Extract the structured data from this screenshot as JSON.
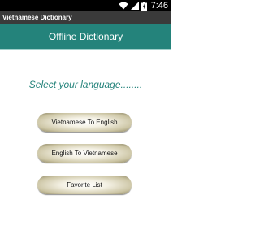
{
  "status_bar": {
    "time": "7:46",
    "icons": [
      "wifi-icon",
      "signal-icon",
      "battery-charging-icon"
    ]
  },
  "app_title": "Vietnamese Dictionary",
  "header": {
    "title": "Offline Dictionary",
    "color": "#24837b"
  },
  "main": {
    "prompt": "Select your language........",
    "buttons": [
      {
        "label": "Vietnamese To English"
      },
      {
        "label": "English To Vietnamese"
      },
      {
        "label": "Favorite List"
      }
    ]
  }
}
